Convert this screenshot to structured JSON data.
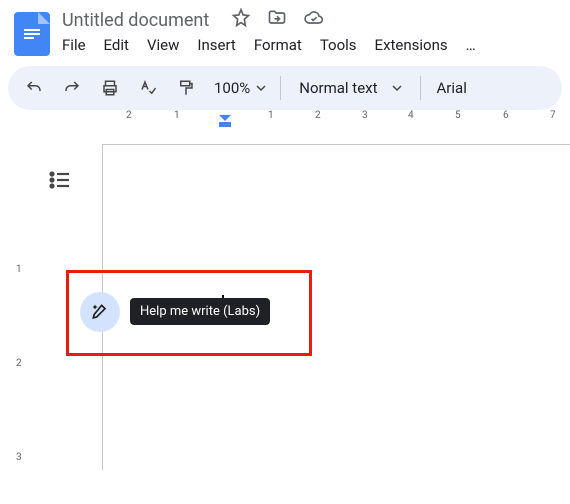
{
  "header": {
    "title": "Untitled document",
    "icons": {
      "star": "star-icon",
      "move": "folder-move-icon",
      "cloud": "cloud-done-icon"
    }
  },
  "menubar": [
    "File",
    "Edit",
    "View",
    "Insert",
    "Format",
    "Tools",
    "Extensions",
    "…"
  ],
  "toolbar": {
    "zoom": "100%",
    "style": "Normal text",
    "font": "Arial"
  },
  "hruler_numbers": [
    2,
    1,
    1,
    2,
    3,
    4,
    5,
    6,
    7
  ],
  "vruler_numbers": [
    1,
    2,
    3
  ],
  "tooltip": "Help me write (Labs)"
}
